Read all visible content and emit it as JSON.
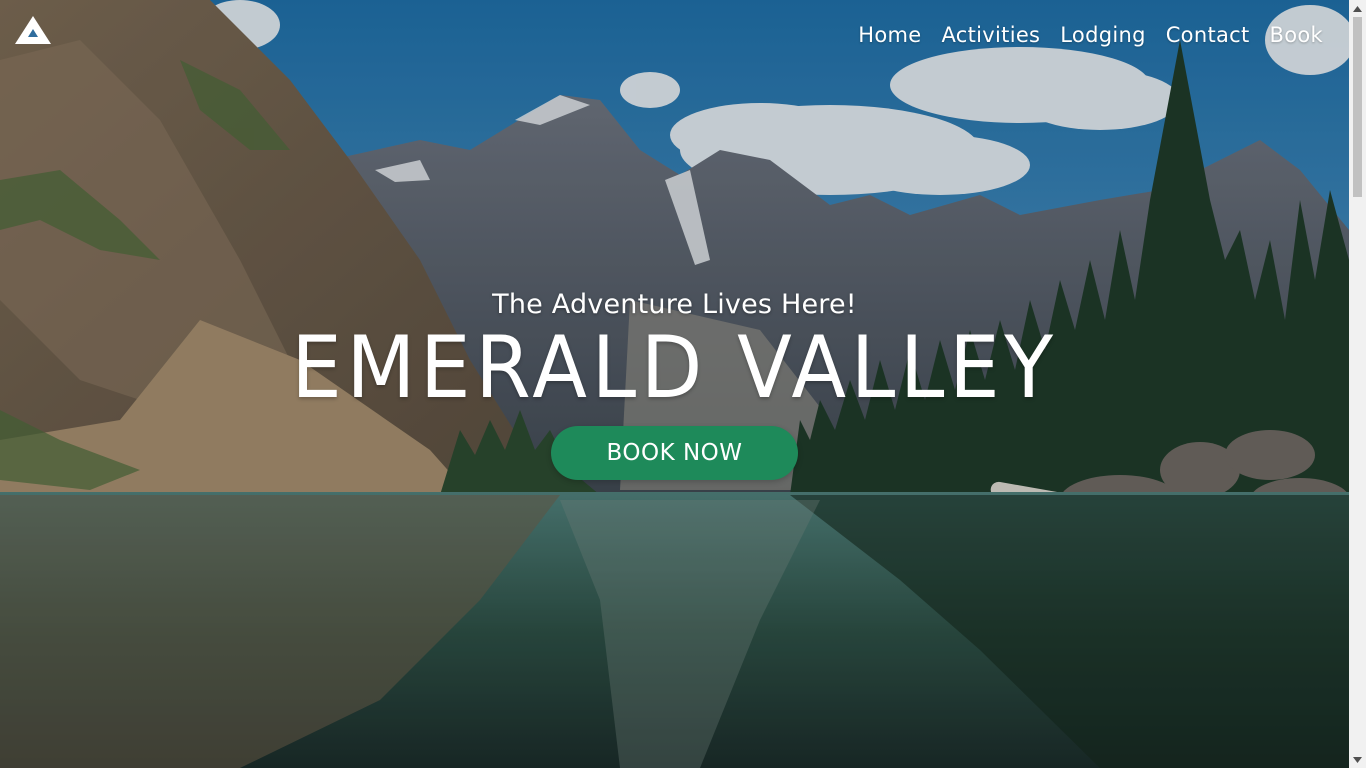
{
  "brand": {
    "logo_icon": "mountain-logo-icon"
  },
  "nav": {
    "items": [
      {
        "label": "Home"
      },
      {
        "label": "Activities"
      },
      {
        "label": "Lodging"
      },
      {
        "label": "Contact"
      },
      {
        "label": "Book"
      }
    ]
  },
  "hero": {
    "tagline": "The Adventure Lives Here!",
    "title": "EMERALD VALLEY",
    "cta_label": "BOOK NOW",
    "background_icon": "mountain-lake-photo"
  },
  "colors": {
    "cta": "#1e8a5a",
    "text": "#ffffff",
    "sky": "#2f6d9e"
  },
  "scrollbar": {
    "up_icon": "arrow-up-icon",
    "down_icon": "arrow-down-icon"
  }
}
